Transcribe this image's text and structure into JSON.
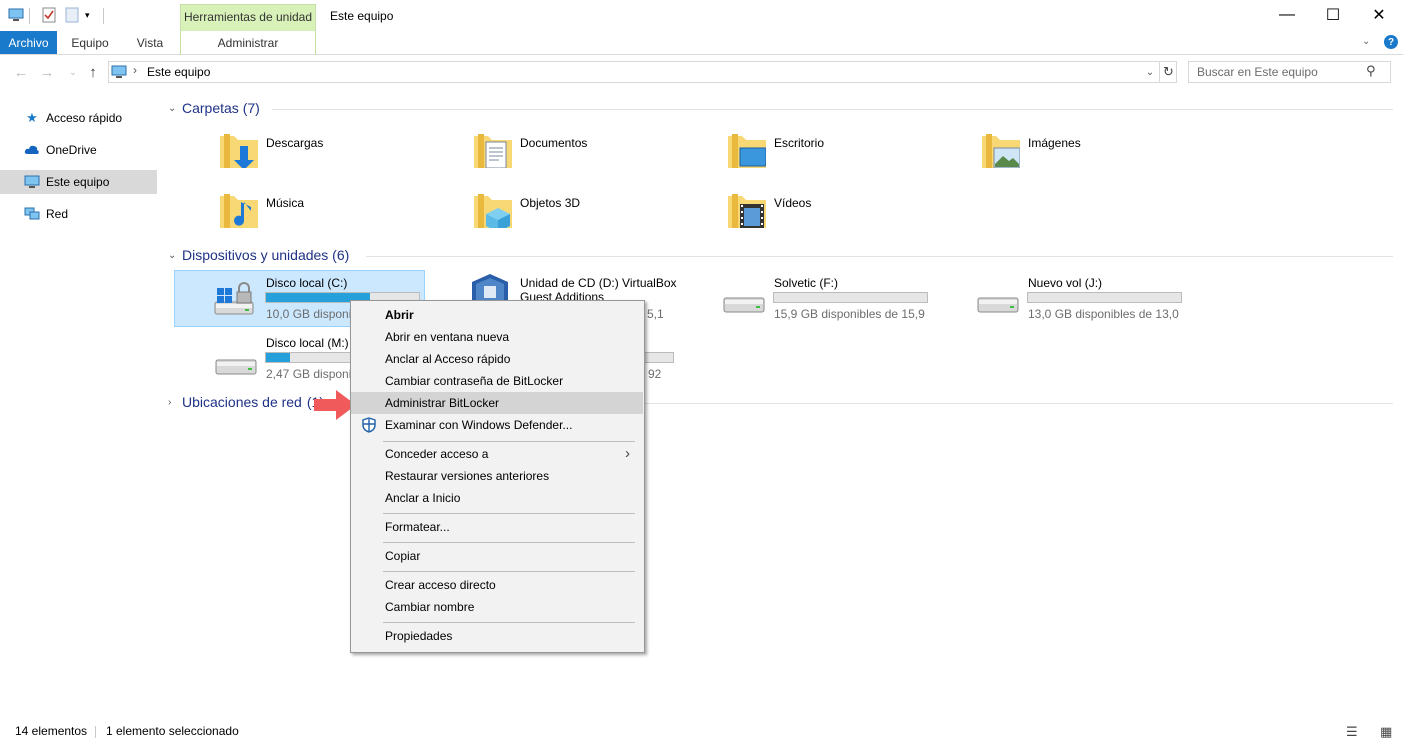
{
  "titlebar": {
    "context_tab_title": "Herramientas de unidad",
    "window_title": "Este equipo",
    "minimize": "—",
    "maximize": "☐",
    "close": "✕"
  },
  "ribbon": {
    "tabs": [
      "Archivo",
      "Equipo",
      "Vista",
      "Administrar"
    ]
  },
  "address": {
    "path": "Este equipo",
    "search_placeholder": "Buscar en Este equipo"
  },
  "nav": {
    "items": [
      "Acceso rápido",
      "OneDrive",
      "Este equipo",
      "Red"
    ],
    "selected": "Este equipo"
  },
  "groups": {
    "carpetas": "Carpetas (7)",
    "dispositivos": "Dispositivos y unidades (6)",
    "ubicaciones": "Ubicaciones de red",
    "ubicaciones_count": "(1)"
  },
  "folders": [
    "Descargas",
    "Documentos",
    "Escritorio",
    "Imágenes",
    "Música",
    "Objetos 3D",
    "Vídeos"
  ],
  "drives": [
    {
      "name": "Disco local (C:)",
      "free": "10,0 GB disponibl",
      "used_fraction": 0.68,
      "selected": true
    },
    {
      "name": "Unidad de CD (D:) VirtualBox",
      "name2": "Guest Additions",
      "free": "5,1"
    },
    {
      "name": "Solvetic (F:)",
      "free": "15,9 GB disponibles de 15,9",
      "used_fraction": 0.0
    },
    {
      "name": "Nuevo vol (J:)",
      "free": "13,0 GB disponibles de 13,0",
      "used_fraction": 0.0
    },
    {
      "name": "Disco local (M:)",
      "free": "2,47 GB disponib",
      "used_fraction": 0.16
    },
    {
      "name": "",
      "free": "92",
      "used_fraction": 0.0
    }
  ],
  "context_menu": {
    "items": [
      "Abrir",
      "Abrir en ventana nueva",
      "Anclar al Acceso rápido",
      "Cambiar contraseña de BitLocker",
      "Administrar BitLocker",
      "Examinar con Windows Defender...",
      "Conceder acceso a",
      "Restaurar versiones anteriores",
      "Anclar a Inicio",
      "Formatear...",
      "Copiar",
      "Crear acceso directo",
      "Cambiar nombre",
      "Propiedades"
    ],
    "highlighted": "Administrar BitLocker"
  },
  "status": {
    "count": "14 elementos",
    "selection": "1 elemento seleccionado"
  },
  "colors": {
    "accent": "#1979ca",
    "selection": "#cce8ff",
    "group_header": "#1e3287",
    "context_tab": "#d8f1b8",
    "arrow": "#f05a5a"
  }
}
